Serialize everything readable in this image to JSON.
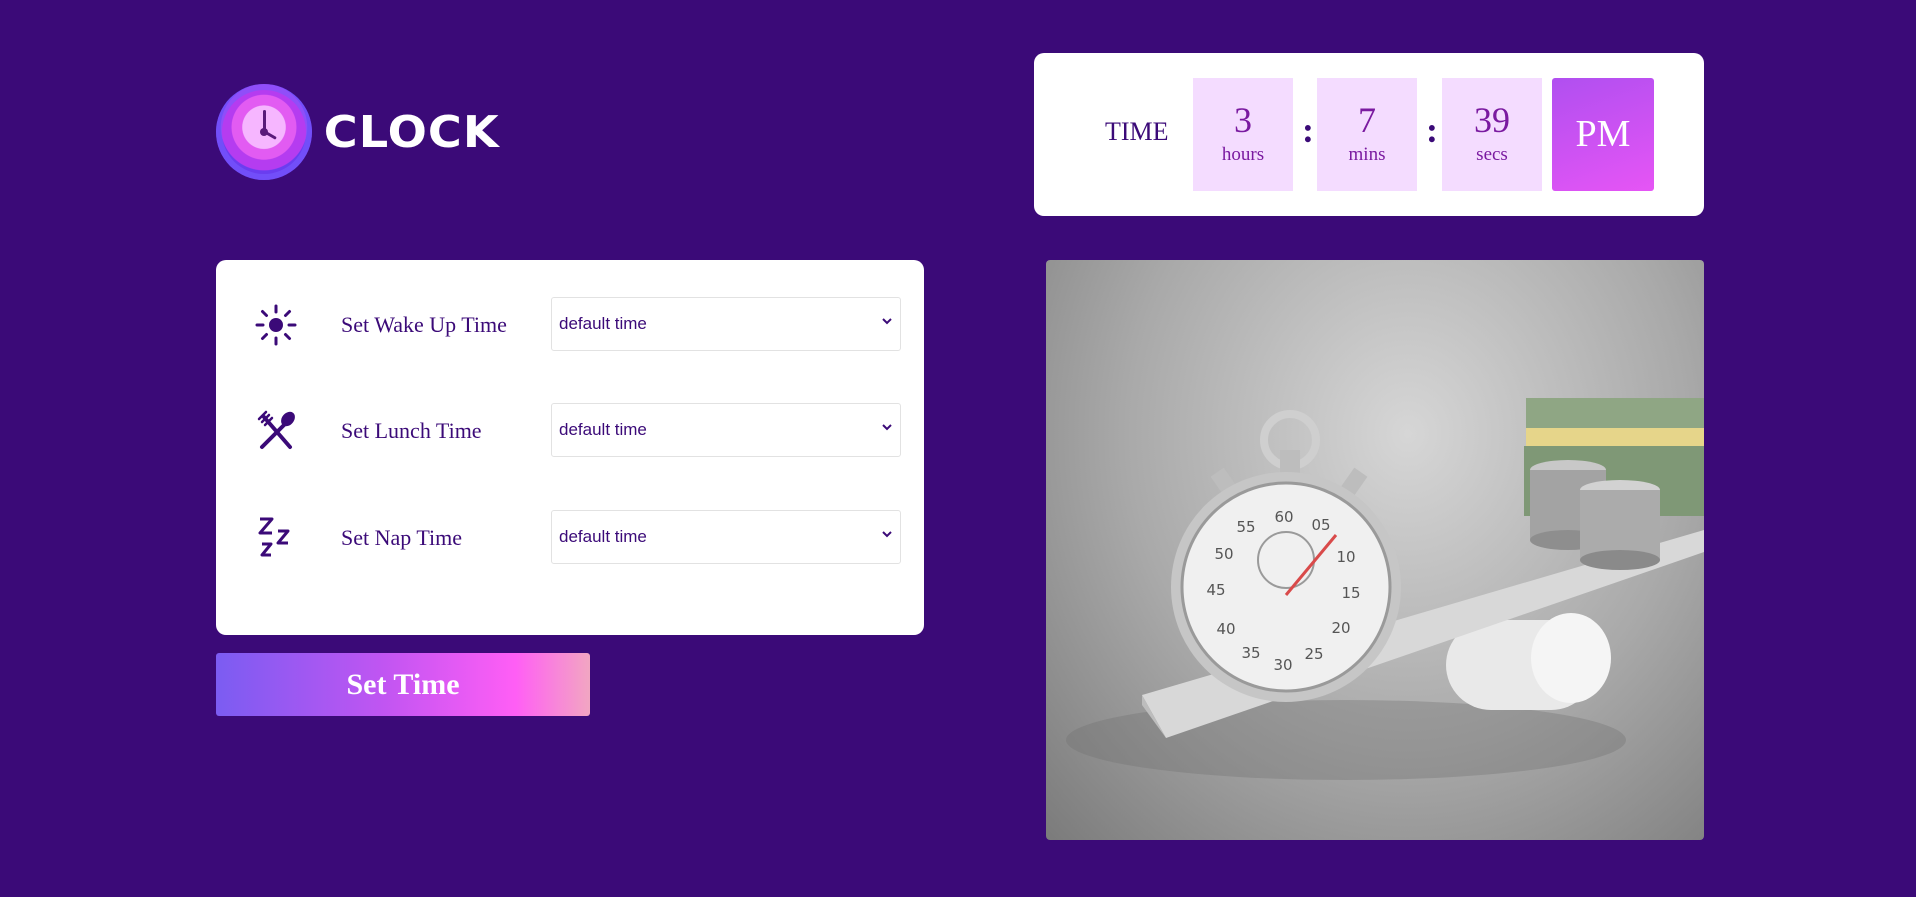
{
  "logo": {
    "text": "CLOCK",
    "icon": "clock-icon"
  },
  "time_display": {
    "label": "TIME",
    "hours": "3",
    "hours_unit": "hours",
    "mins": "7",
    "mins_unit": "mins",
    "secs": "39",
    "secs_unit": "secs",
    "separator": ":",
    "ampm": "PM"
  },
  "settings": {
    "rows": [
      {
        "label": "Set Wake Up Time",
        "icon": "sun-icon",
        "value": "default time"
      },
      {
        "label": "Set Lunch Time",
        "icon": "fork-spoon-icon",
        "value": "default time"
      },
      {
        "label": "Set Nap Time",
        "icon": "zzz-icon",
        "value": "default time"
      }
    ]
  },
  "button": {
    "label": "Set Time"
  },
  "colors": {
    "background": "#3b0a78",
    "accent": "#e655f5",
    "box": "#f4dcff"
  }
}
